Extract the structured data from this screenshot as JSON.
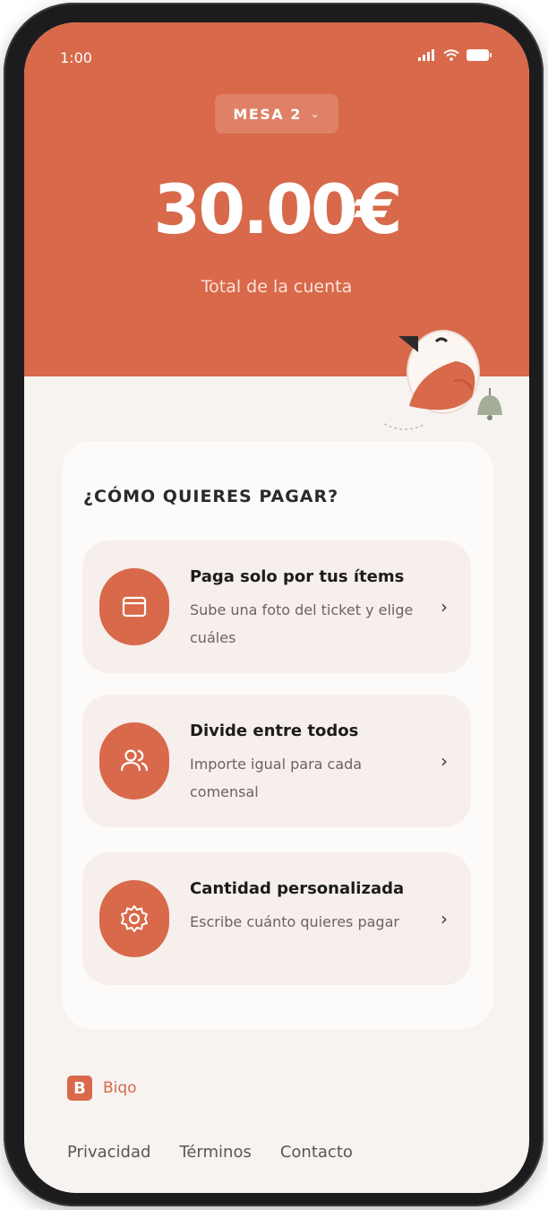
{
  "status_bar": {
    "time": "1:00",
    "icons": [
      "cellular-icon",
      "wifi-icon",
      "battery-icon"
    ]
  },
  "header": {
    "table_selector": {
      "label": "MESA 2",
      "icon": "chevron-down-icon"
    },
    "amount": "30.00€",
    "amount_label": "Total de la cuenta"
  },
  "payment": {
    "title": "¿CÓMO QUIERES PAGAR?",
    "options": [
      {
        "icon": "receipt-icon",
        "title": "Paga solo por tus ítems",
        "description": "Sube una foto del ticket y elige cuáles"
      },
      {
        "icon": "users-icon",
        "title": "Divide entre todos",
        "description": "Importe igual para cada comensal"
      },
      {
        "icon": "gear-icon",
        "title": "Cantidad personalizada",
        "description": "Escribe cuánto quieres pagar"
      }
    ]
  },
  "footer": {
    "brand_letter": "B",
    "brand_name": "Biqo",
    "links": [
      "Privacidad",
      "Términos",
      "Contacto"
    ]
  },
  "colors": {
    "primary": "#d8694a",
    "background": "#f7f3f1",
    "option_bg": "#f6efeb"
  }
}
